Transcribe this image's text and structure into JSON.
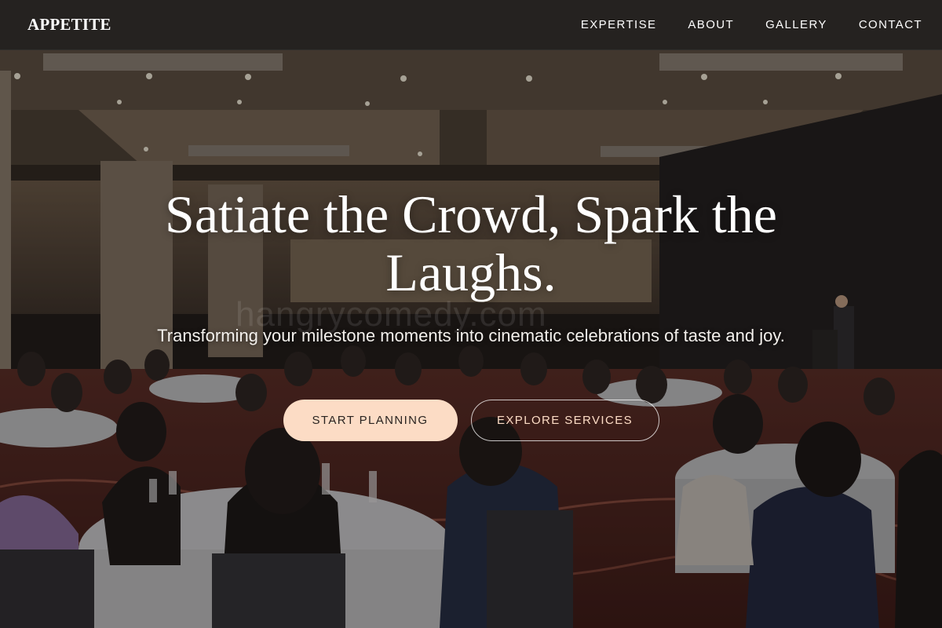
{
  "brand": {
    "logo": "APPETITE"
  },
  "nav": {
    "items": [
      "EXPERTISE",
      "ABOUT",
      "GALLERY",
      "CONTACT"
    ]
  },
  "hero": {
    "title": "Satiate the Crowd, Spark the Laughs.",
    "subtitle": "Transforming your milestone moments into cinematic celebrations of taste and joy.",
    "watermark": "hangrycomedy.com"
  },
  "cta": {
    "primary": "START PLANNING",
    "secondary": "EXPLORE SERVICES"
  },
  "colors": {
    "accent": "#fcdcc5",
    "header_bg": "#262321",
    "text": "#ffffff"
  }
}
